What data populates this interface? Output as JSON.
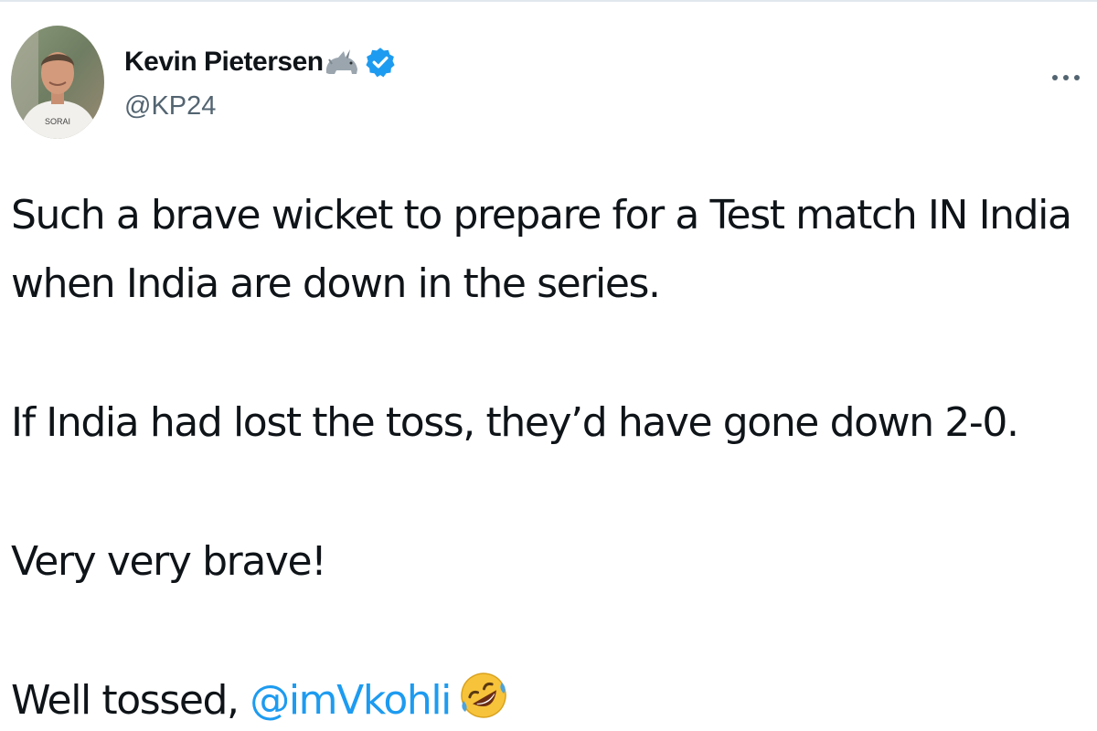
{
  "author": {
    "display_name": "Kevin Pietersen",
    "handle": "@KP24",
    "name_emoji_icon": "rhino-icon",
    "verified_icon": "verified-badge-icon",
    "avatar_shirt_text": "SORAI"
  },
  "menu": {
    "icon": "more-options-icon"
  },
  "tweet": {
    "line_1": "Such a brave wicket to prepare for a Test match IN India",
    "line_2": "when India are down in the series.",
    "paragraph_2": "If India had lost the toss, they’d have gone down 2-0.",
    "paragraph_3": "Very very brave!",
    "paragraph_4_prefix": "Well tossed, ",
    "mention": "@imVkohli",
    "end_emoji_icon": "rolling-on-floor-laughing-icon"
  },
  "colors": {
    "text": "#0f1419",
    "secondary": "#536471",
    "link": "#1d9bf0",
    "verified": "#1d9bf0"
  }
}
